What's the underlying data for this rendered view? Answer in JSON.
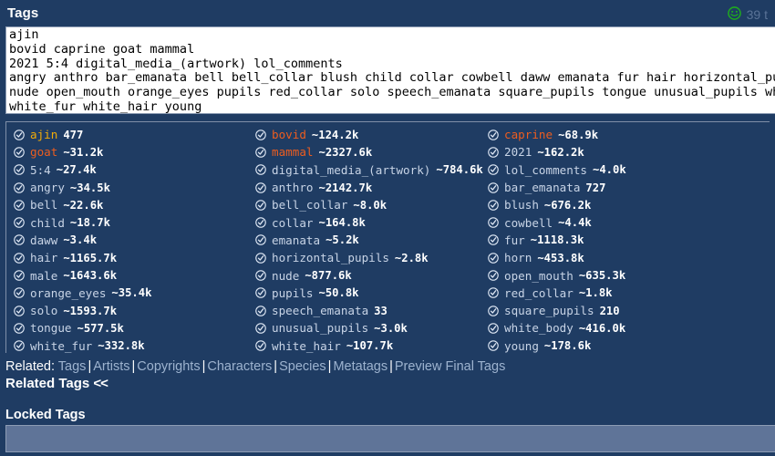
{
  "header": {
    "title": "Tags",
    "smiley_icon": "smiley-face-icon",
    "count_label": "39 t"
  },
  "tag_textarea": {
    "value": "ajin\nbovid caprine goat mammal\n2021 5:4 digital_media_(artwork) lol_comments\nangry anthro bar_emanata bell bell_collar blush child collar cowbell daww emanata fur hair horizontal_pupils horn\nnude open_mouth orange_eyes pupils red_collar solo speech_emanata square_pupils tongue unusual_pupils white_body\nwhite_fur white_hair young",
    "placeholder": ""
  },
  "colors": {
    "background": "#1f3c63",
    "character": "#f2ac08",
    "species": "#ed5d1f",
    "general": "#c8d4e6",
    "smiley": "#1faa1f",
    "locked_box": "#5f7498"
  },
  "tag_list": {
    "columns": [
      {
        "rows": [
          {
            "name": "ajin",
            "count": "477",
            "category": "character"
          },
          {
            "name": "goat",
            "count": "~31.2k",
            "category": "species"
          },
          {
            "name": "5:4",
            "count": "~27.4k",
            "category": "general"
          },
          {
            "name": "angry",
            "count": "~34.5k",
            "category": "general"
          },
          {
            "name": "bell",
            "count": "~22.6k",
            "category": "general"
          },
          {
            "name": "child",
            "count": "~18.7k",
            "category": "general"
          },
          {
            "name": "daww",
            "count": "~3.4k",
            "category": "general"
          },
          {
            "name": "hair",
            "count": "~1165.7k",
            "category": "general"
          },
          {
            "name": "male",
            "count": "~1643.6k",
            "category": "general"
          },
          {
            "name": "orange_eyes",
            "count": "~35.4k",
            "category": "general"
          },
          {
            "name": "solo",
            "count": "~1593.7k",
            "category": "general"
          },
          {
            "name": "tongue",
            "count": "~577.5k",
            "category": "general"
          },
          {
            "name": "white_fur",
            "count": "~332.8k",
            "category": "general"
          }
        ]
      },
      {
        "rows": [
          {
            "name": "bovid",
            "count": "~124.2k",
            "category": "species"
          },
          {
            "name": "mammal",
            "count": "~2327.6k",
            "category": "species"
          },
          {
            "name": "digital_media_(artwork)",
            "count": "~784.6k",
            "category": "general"
          },
          {
            "name": "anthro",
            "count": "~2142.7k",
            "category": "general"
          },
          {
            "name": "bell_collar",
            "count": "~8.0k",
            "category": "general"
          },
          {
            "name": "collar",
            "count": "~164.8k",
            "category": "general"
          },
          {
            "name": "emanata",
            "count": "~5.2k",
            "category": "general"
          },
          {
            "name": "horizontal_pupils",
            "count": "~2.8k",
            "category": "general"
          },
          {
            "name": "nude",
            "count": "~877.6k",
            "category": "general"
          },
          {
            "name": "pupils",
            "count": "~50.8k",
            "category": "general"
          },
          {
            "name": "speech_emanata",
            "count": "33",
            "category": "general"
          },
          {
            "name": "unusual_pupils",
            "count": "~3.0k",
            "category": "general"
          },
          {
            "name": "white_hair",
            "count": "~107.7k",
            "category": "general"
          }
        ]
      },
      {
        "rows": [
          {
            "name": "caprine",
            "count": "~68.9k",
            "category": "species"
          },
          {
            "name": "2021",
            "count": "~162.2k",
            "category": "general"
          },
          {
            "name": "lol_comments",
            "count": "~4.0k",
            "category": "general"
          },
          {
            "name": "bar_emanata",
            "count": "727",
            "category": "general"
          },
          {
            "name": "blush",
            "count": "~676.2k",
            "category": "general"
          },
          {
            "name": "cowbell",
            "count": "~4.4k",
            "category": "general"
          },
          {
            "name": "fur",
            "count": "~1118.3k",
            "category": "general"
          },
          {
            "name": "horn",
            "count": "~453.8k",
            "category": "general"
          },
          {
            "name": "open_mouth",
            "count": "~635.3k",
            "category": "general"
          },
          {
            "name": "red_collar",
            "count": "~1.8k",
            "category": "general"
          },
          {
            "name": "square_pupils",
            "count": "210",
            "category": "general"
          },
          {
            "name": "white_body",
            "count": "~416.0k",
            "category": "general"
          },
          {
            "name": "young",
            "count": "~178.6k",
            "category": "general"
          }
        ]
      }
    ]
  },
  "related": {
    "label": "Related:",
    "links": [
      "Tags",
      "Artists",
      "Copyrights",
      "Characters",
      "Species",
      "Metatags",
      "Preview Final Tags"
    ],
    "separator": "|"
  },
  "related_tags": {
    "title": "Related Tags",
    "collapse": "<<"
  },
  "locked_tags": {
    "title": "Locked Tags",
    "value": ""
  }
}
